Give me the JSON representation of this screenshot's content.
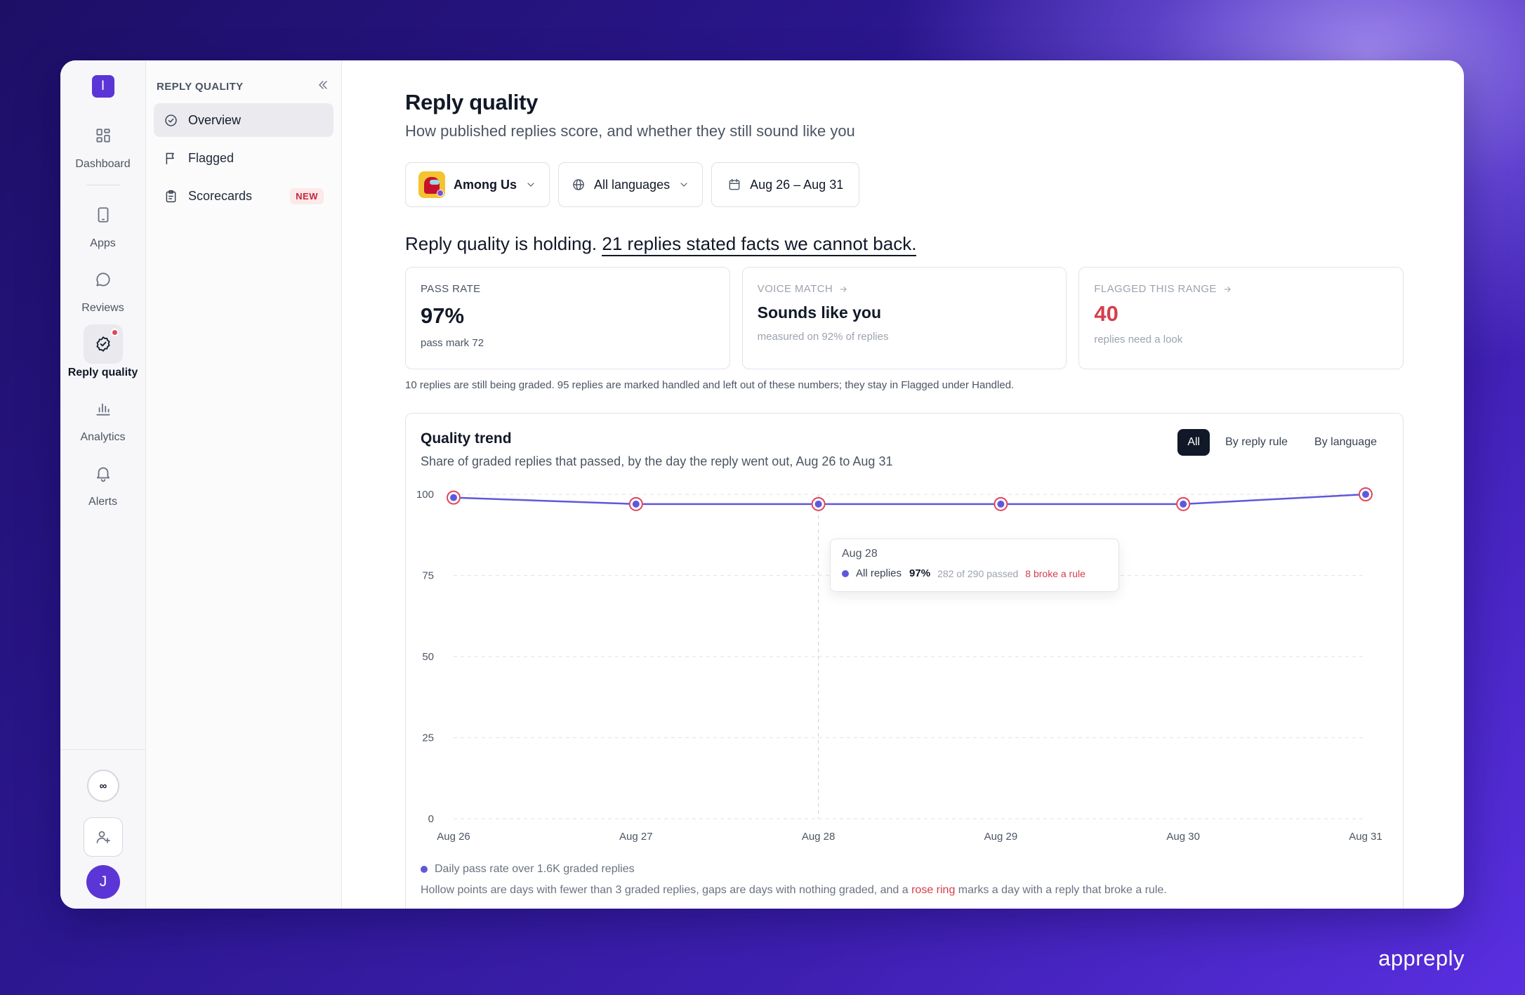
{
  "app": {
    "logo_letter": "I",
    "brand": "appreply"
  },
  "rail": {
    "items": [
      {
        "label": "Dashboard",
        "icon": "dashboard-icon"
      },
      {
        "label": "Apps",
        "icon": "phone-icon"
      },
      {
        "label": "Reviews",
        "icon": "chat-icon"
      },
      {
        "label": "Reply quality",
        "icon": "badge-check-icon",
        "active": true,
        "badge": true
      },
      {
        "label": "Analytics",
        "icon": "bar-chart-icon"
      },
      {
        "label": "Alerts",
        "icon": "bell-icon"
      }
    ],
    "infinity": "∞",
    "avatar": "J"
  },
  "subnav": {
    "title": "REPLY QUALITY",
    "items": [
      {
        "label": "Overview",
        "active": true
      },
      {
        "label": "Flagged"
      },
      {
        "label": "Scorecards",
        "badge": "NEW"
      }
    ]
  },
  "page": {
    "title": "Reply quality",
    "subtitle": "How published replies score, and whether they still sound like you",
    "filters": {
      "app": "Among Us",
      "language": "All languages",
      "date_range": "Aug 26 – Aug 31"
    },
    "headline_prefix": "Reply quality is holding.",
    "headline_link": "21 replies stated facts we cannot back."
  },
  "cards": [
    {
      "label": "PASS RATE",
      "value": "97%",
      "note": "pass mark 72"
    },
    {
      "label": "VOICE MATCH",
      "value": "Sounds like you",
      "note": "measured on 92% of replies"
    },
    {
      "label": "FLAGGED THIS RANGE",
      "value": "40",
      "note": "replies need a look"
    }
  ],
  "note": "10 replies are still being graded. 95 replies are marked handled and left out of these numbers; they stay in Flagged under Handled.",
  "chart": {
    "title": "Quality trend",
    "subtitle": "Share of graded replies that passed, by the day the reply went out, Aug 26 to Aug 31",
    "segments": [
      "All",
      "By reply rule",
      "By language"
    ],
    "legend": "Daily pass rate over 1.6K graded replies",
    "footnote_before": "Hollow points are days with fewer than 3 graded replies, gaps are days with nothing graded, and a",
    "footnote_rose": "rose ring",
    "footnote_after": "marks a day with a reply that broke a rule.",
    "tooltip": {
      "date": "Aug 28",
      "series": "All replies",
      "value": "97%",
      "detail": "282 of 290 passed",
      "broke": "8 broke a rule"
    }
  },
  "chart_data": {
    "type": "line",
    "x": [
      "Aug 26",
      "Aug 27",
      "Aug 28",
      "Aug 29",
      "Aug 30",
      "Aug 31"
    ],
    "series": [
      {
        "name": "All replies",
        "values": [
          99,
          97,
          97,
          97,
          97,
          100
        ]
      }
    ],
    "rose_ring": [
      true,
      true,
      true,
      true,
      true,
      true
    ],
    "ylim": [
      0,
      100
    ],
    "yticks": [
      0,
      25,
      50,
      75,
      100
    ],
    "highlight_index": 2,
    "grid": true,
    "colors": {
      "line": "#6058dc",
      "ring": "#e0475a"
    }
  }
}
